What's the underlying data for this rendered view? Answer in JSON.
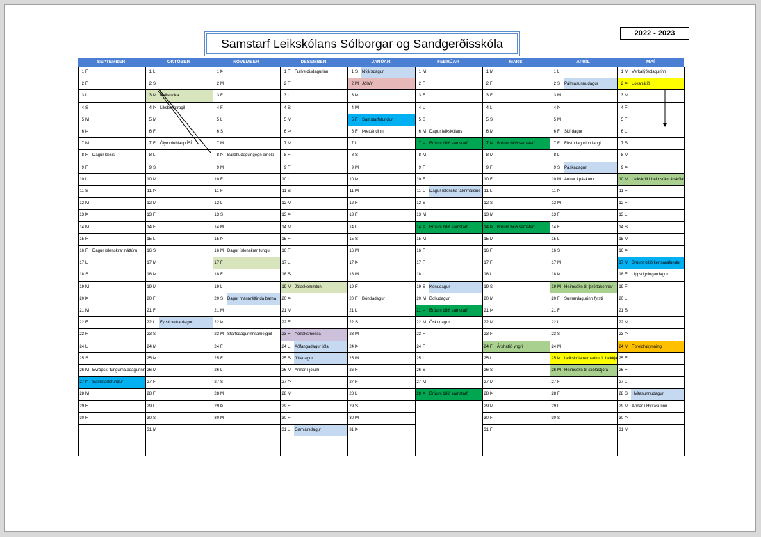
{
  "title": "Samstarf Leikskólans Sólborgar og Sandgerðisskóla",
  "year": "2022 - 2023",
  "colors": {
    "header": "#4a7fd4",
    "weekend": "#c5d9f1",
    "green_light": "#d8e4bc",
    "green_dark": "#00a651",
    "cyan": "#00b0f0",
    "yellow": "#ffff00",
    "pink": "#e6b8b7",
    "purple": "#ccc0da",
    "orange": "#ffc000",
    "green_mid": "#a9d08e"
  },
  "months": [
    {
      "name": "SEPTEMBER",
      "days": [
        [
          "1",
          "F",
          ""
        ],
        [
          "2",
          "F",
          ""
        ],
        [
          "3",
          "L",
          ""
        ],
        [
          "4",
          "S",
          ""
        ],
        [
          "5",
          "M",
          ""
        ],
        [
          "6",
          "Þ",
          ""
        ],
        [
          "7",
          "M",
          ""
        ],
        [
          "8",
          "F",
          "Dagur læsis"
        ],
        [
          "9",
          "F",
          ""
        ],
        [
          "10",
          "L",
          ""
        ],
        [
          "11",
          "S",
          ""
        ],
        [
          "12",
          "M",
          ""
        ],
        [
          "13",
          "Þ",
          ""
        ],
        [
          "14",
          "M",
          ""
        ],
        [
          "15",
          "F",
          ""
        ],
        [
          "16",
          "F",
          "Dagur íslenskrar náttúru"
        ],
        [
          "17",
          "L",
          ""
        ],
        [
          "18",
          "S",
          ""
        ],
        [
          "19",
          "M",
          ""
        ],
        [
          "20",
          "Þ",
          ""
        ],
        [
          "21",
          "M",
          ""
        ],
        [
          "22",
          "F",
          ""
        ],
        [
          "23",
          "F",
          ""
        ],
        [
          "24",
          "L",
          ""
        ],
        [
          "25",
          "S",
          ""
        ],
        [
          "26",
          "M",
          "Evrópskl tungumáladagurinn"
        ],
        [
          "27",
          "Þ",
          "Samstarfsfundur"
        ],
        [
          "28",
          "M",
          ""
        ],
        [
          "29",
          "F",
          ""
        ],
        [
          "30",
          "F",
          ""
        ]
      ]
    },
    {
      "name": "OKTÓBER",
      "days": [
        [
          "1",
          "L",
          ""
        ],
        [
          "2",
          "S",
          ""
        ],
        [
          "3",
          "M",
          "Heilsuvika"
        ],
        [
          "4",
          "Þ",
          "Liksbollafragil"
        ],
        [
          "5",
          "M",
          ""
        ],
        [
          "6",
          "F",
          ""
        ],
        [
          "7",
          "F",
          "Ólympíuhlaup ÍSÍ"
        ],
        [
          "8",
          "L",
          ""
        ],
        [
          "9",
          "S",
          ""
        ],
        [
          "10",
          "M",
          ""
        ],
        [
          "11",
          "Þ",
          ""
        ],
        [
          "12",
          "M",
          ""
        ],
        [
          "13",
          "F",
          ""
        ],
        [
          "14",
          "F",
          ""
        ],
        [
          "15",
          "L",
          ""
        ],
        [
          "16",
          "S",
          ""
        ],
        [
          "17",
          "M",
          ""
        ],
        [
          "18",
          "Þ",
          ""
        ],
        [
          "19",
          "M",
          ""
        ],
        [
          "20",
          "F",
          ""
        ],
        [
          "21",
          "F",
          ""
        ],
        [
          "22",
          "L",
          "Fyrsti vetrardagur"
        ],
        [
          "23",
          "S",
          ""
        ],
        [
          "24",
          "M",
          ""
        ],
        [
          "25",
          "Þ",
          ""
        ],
        [
          "26",
          "M",
          ""
        ],
        [
          "27",
          "F",
          ""
        ],
        [
          "28",
          "F",
          ""
        ],
        [
          "29",
          "L",
          ""
        ],
        [
          "30",
          "S",
          ""
        ],
        [
          "31",
          "M",
          ""
        ]
      ]
    },
    {
      "name": "NÓVEMBER",
      "days": [
        [
          "1",
          "Þ",
          ""
        ],
        [
          "2",
          "M",
          ""
        ],
        [
          "3",
          "F",
          ""
        ],
        [
          "4",
          "F",
          ""
        ],
        [
          "5",
          "L",
          ""
        ],
        [
          "6",
          "S",
          ""
        ],
        [
          "7",
          "M",
          ""
        ],
        [
          "8",
          "Þ",
          "Baráttudagur gegn einelti"
        ],
        [
          "9",
          "M",
          ""
        ],
        [
          "10",
          "F",
          ""
        ],
        [
          "11",
          "F",
          ""
        ],
        [
          "12",
          "L",
          ""
        ],
        [
          "13",
          "S",
          ""
        ],
        [
          "14",
          "M",
          ""
        ],
        [
          "15",
          "Þ",
          ""
        ],
        [
          "16",
          "M",
          "Dagur íslenskrar tungu"
        ],
        [
          "17",
          "F",
          ""
        ],
        [
          "18",
          "F",
          ""
        ],
        [
          "19",
          "L",
          ""
        ],
        [
          "20",
          "S",
          "Dagur mannréttinda barna"
        ],
        [
          "21",
          "M",
          ""
        ],
        [
          "22",
          "Þ",
          ""
        ],
        [
          "23",
          "M",
          "Starfsdagurinnsameiginl"
        ],
        [
          "24",
          "F",
          ""
        ],
        [
          "25",
          "F",
          ""
        ],
        [
          "26",
          "L",
          ""
        ],
        [
          "27",
          "S",
          ""
        ],
        [
          "28",
          "M",
          ""
        ],
        [
          "29",
          "Þ",
          ""
        ],
        [
          "30",
          "M",
          ""
        ]
      ]
    },
    {
      "name": "DESEMBER",
      "days": [
        [
          "1",
          "F",
          "Fullveldisdagurinn"
        ],
        [
          "2",
          "F",
          ""
        ],
        [
          "3",
          "L",
          ""
        ],
        [
          "4",
          "S",
          ""
        ],
        [
          "5",
          "M",
          ""
        ],
        [
          "6",
          "Þ",
          ""
        ],
        [
          "7",
          "M",
          ""
        ],
        [
          "8",
          "F",
          ""
        ],
        [
          "9",
          "F",
          ""
        ],
        [
          "10",
          "L",
          ""
        ],
        [
          "11",
          "S",
          ""
        ],
        [
          "12",
          "M",
          ""
        ],
        [
          "13",
          "Þ",
          ""
        ],
        [
          "14",
          "M",
          ""
        ],
        [
          "15",
          "F",
          ""
        ],
        [
          "16",
          "F",
          ""
        ],
        [
          "17",
          "L",
          ""
        ],
        [
          "18",
          "S",
          ""
        ],
        [
          "19",
          "M",
          "Jólaskemmtun"
        ],
        [
          "20",
          "Þ",
          ""
        ],
        [
          "21",
          "M",
          ""
        ],
        [
          "22",
          "F",
          ""
        ],
        [
          "23",
          "F",
          "Þorláksmessa"
        ],
        [
          "24",
          "L",
          "Aðfangadagur jóla"
        ],
        [
          "25",
          "S",
          "Jóladagur"
        ],
        [
          "26",
          "M",
          "Annar í jólum"
        ],
        [
          "27",
          "Þ",
          ""
        ],
        [
          "28",
          "M",
          ""
        ],
        [
          "29",
          "F",
          ""
        ],
        [
          "30",
          "F",
          ""
        ],
        [
          "31",
          "L",
          "Gamlársdagur"
        ]
      ]
    },
    {
      "name": "JANÚAR",
      "days": [
        [
          "1",
          "S",
          "Nýársdagur"
        ],
        [
          "2",
          "M",
          "Jólafrí"
        ],
        [
          "3",
          "Þ",
          ""
        ],
        [
          "4",
          "M",
          ""
        ],
        [
          "5",
          "F",
          "Samstarfsfundur"
        ],
        [
          "6",
          "F",
          "Þrettándinn"
        ],
        [
          "7",
          "L",
          ""
        ],
        [
          "8",
          "S",
          ""
        ],
        [
          "9",
          "M",
          ""
        ],
        [
          "10",
          "Þ",
          ""
        ],
        [
          "11",
          "M",
          ""
        ],
        [
          "12",
          "F",
          ""
        ],
        [
          "13",
          "F",
          ""
        ],
        [
          "14",
          "L",
          ""
        ],
        [
          "15",
          "S",
          ""
        ],
        [
          "16",
          "M",
          ""
        ],
        [
          "17",
          "Þ",
          ""
        ],
        [
          "18",
          "M",
          ""
        ],
        [
          "19",
          "F",
          ""
        ],
        [
          "20",
          "F",
          "Bóndadagur"
        ],
        [
          "21",
          "L",
          ""
        ],
        [
          "22",
          "S",
          ""
        ],
        [
          "23",
          "M",
          ""
        ],
        [
          "24",
          "Þ",
          ""
        ],
        [
          "25",
          "M",
          ""
        ],
        [
          "26",
          "F",
          ""
        ],
        [
          "27",
          "F",
          ""
        ],
        [
          "28",
          "L",
          ""
        ],
        [
          "29",
          "S",
          ""
        ],
        [
          "30",
          "M",
          ""
        ],
        [
          "31",
          "Þ",
          ""
        ]
      ]
    },
    {
      "name": "FEBRÚAR",
      "days": [
        [
          "1",
          "M",
          ""
        ],
        [
          "2",
          "F",
          ""
        ],
        [
          "3",
          "F",
          ""
        ],
        [
          "4",
          "L",
          ""
        ],
        [
          "5",
          "S",
          ""
        ],
        [
          "6",
          "M",
          "Dagur leikskólans"
        ],
        [
          "7",
          "Þ",
          "Brúum bilið samstarf"
        ],
        [
          "8",
          "M",
          ""
        ],
        [
          "9",
          "F",
          ""
        ],
        [
          "10",
          "F",
          ""
        ],
        [
          "11",
          "L",
          "Dagur íslenska táknmálsins"
        ],
        [
          "12",
          "S",
          ""
        ],
        [
          "13",
          "M",
          ""
        ],
        [
          "14",
          "Þ",
          "Brúum bilið samstarf"
        ],
        [
          "15",
          "M",
          ""
        ],
        [
          "16",
          "F",
          ""
        ],
        [
          "17",
          "F",
          ""
        ],
        [
          "18",
          "L",
          ""
        ],
        [
          "19",
          "S",
          "Konudagur"
        ],
        [
          "20",
          "M",
          "Bolludagur"
        ],
        [
          "21",
          "Þ",
          "Brúum bilið samstarf"
        ],
        [
          "22",
          "M",
          "Öskudagur"
        ],
        [
          "23",
          "F",
          ""
        ],
        [
          "24",
          "F",
          ""
        ],
        [
          "25",
          "L",
          ""
        ],
        [
          "26",
          "S",
          ""
        ],
        [
          "27",
          "M",
          ""
        ],
        [
          "28",
          "Þ",
          "Brúum bilið samstarf"
        ]
      ]
    },
    {
      "name": "MARS",
      "days": [
        [
          "1",
          "M",
          ""
        ],
        [
          "2",
          "F",
          ""
        ],
        [
          "3",
          "F",
          ""
        ],
        [
          "4",
          "L",
          ""
        ],
        [
          "5",
          "S",
          ""
        ],
        [
          "6",
          "M",
          ""
        ],
        [
          "7",
          "Þ",
          "Brúum bilið samstarf"
        ],
        [
          "8",
          "M",
          ""
        ],
        [
          "9",
          "F",
          ""
        ],
        [
          "10",
          "F",
          ""
        ],
        [
          "11",
          "L",
          ""
        ],
        [
          "12",
          "S",
          ""
        ],
        [
          "13",
          "M",
          ""
        ],
        [
          "14",
          "Þ",
          "Brúum bilið samstarf"
        ],
        [
          "15",
          "M",
          ""
        ],
        [
          "16",
          "F",
          ""
        ],
        [
          "17",
          "F",
          ""
        ],
        [
          "18",
          "L",
          ""
        ],
        [
          "19",
          "S",
          ""
        ],
        [
          "20",
          "M",
          ""
        ],
        [
          "21",
          "Þ",
          ""
        ],
        [
          "22",
          "M",
          ""
        ],
        [
          "23",
          "F",
          ""
        ],
        [
          "24",
          "F",
          "Árshátíð yngri"
        ],
        [
          "25",
          "L",
          ""
        ],
        [
          "26",
          "S",
          ""
        ],
        [
          "27",
          "M",
          ""
        ],
        [
          "28",
          "Þ",
          ""
        ],
        [
          "29",
          "M",
          ""
        ],
        [
          "30",
          "F",
          ""
        ],
        [
          "31",
          "F",
          ""
        ]
      ]
    },
    {
      "name": "APRÍL",
      "days": [
        [
          "1",
          "L",
          ""
        ],
        [
          "2",
          "S",
          "Pálmasunnudagur"
        ],
        [
          "3",
          "M",
          ""
        ],
        [
          "4",
          "Þ",
          ""
        ],
        [
          "5",
          "M",
          ""
        ],
        [
          "6",
          "F",
          "Skírdagur"
        ],
        [
          "7",
          "F",
          "Föstudagurinn langi"
        ],
        [
          "8",
          "L",
          ""
        ],
        [
          "9",
          "S",
          "Páskadagur"
        ],
        [
          "10",
          "M",
          "Annar í páskum"
        ],
        [
          "11",
          "Þ",
          ""
        ],
        [
          "12",
          "M",
          ""
        ],
        [
          "13",
          "F",
          ""
        ],
        [
          "14",
          "F",
          ""
        ],
        [
          "15",
          "L",
          ""
        ],
        [
          "16",
          "S",
          ""
        ],
        [
          "17",
          "M",
          ""
        ],
        [
          "18",
          "Þ",
          ""
        ],
        [
          "19",
          "M",
          "Heimsókn til íþróttakennar"
        ],
        [
          "20",
          "F",
          "Sumardagurinn fyrsti"
        ],
        [
          "21",
          "F",
          ""
        ],
        [
          "22",
          "L",
          ""
        ],
        [
          "23",
          "S",
          ""
        ],
        [
          "24",
          "M",
          ""
        ],
        [
          "25",
          "Þ",
          "Leikskólaheimsókn 1. bekkjar"
        ],
        [
          "26",
          "M",
          "Heimsókn til skólastjóra"
        ],
        [
          "27",
          "F",
          ""
        ],
        [
          "28",
          "F",
          ""
        ],
        [
          "29",
          "L",
          ""
        ],
        [
          "30",
          "S",
          ""
        ]
      ]
    },
    {
      "name": "MAÍ",
      "days": [
        [
          "1",
          "M",
          "Verkalýðsdagurinn"
        ],
        [
          "2",
          "Þ",
          "Lokahátíð"
        ],
        [
          "3",
          "M",
          ""
        ],
        [
          "4",
          "F",
          ""
        ],
        [
          "5",
          "F",
          ""
        ],
        [
          "6",
          "L",
          ""
        ],
        [
          "7",
          "S",
          ""
        ],
        [
          "8",
          "M",
          ""
        ],
        [
          "9",
          "Þ",
          ""
        ],
        [
          "10",
          "M",
          "Leikskóli í heimsókn á skólasafn"
        ],
        [
          "11",
          "F",
          ""
        ],
        [
          "12",
          "F",
          ""
        ],
        [
          "13",
          "L",
          ""
        ],
        [
          "14",
          "S",
          ""
        ],
        [
          "15",
          "M",
          ""
        ],
        [
          "16",
          "Þ",
          ""
        ],
        [
          "17",
          "M",
          "Brúum bilið kennarafundur"
        ],
        [
          "18",
          "F",
          "Uppstigningardagur"
        ],
        [
          "19",
          "F",
          ""
        ],
        [
          "20",
          "L",
          ""
        ],
        [
          "21",
          "S",
          ""
        ],
        [
          "22",
          "M",
          ""
        ],
        [
          "23",
          "Þ",
          ""
        ],
        [
          "24",
          "M",
          "Foreldrakynning"
        ],
        [
          "25",
          "F",
          ""
        ],
        [
          "26",
          "F",
          ""
        ],
        [
          "27",
          "L",
          ""
        ],
        [
          "28",
          "S",
          "Hvítasunnudagur"
        ],
        [
          "29",
          "M",
          "Annar í Hvítasunnu"
        ],
        [
          "30",
          "Þ",
          ""
        ],
        [
          "31",
          "M",
          ""
        ]
      ]
    }
  ]
}
